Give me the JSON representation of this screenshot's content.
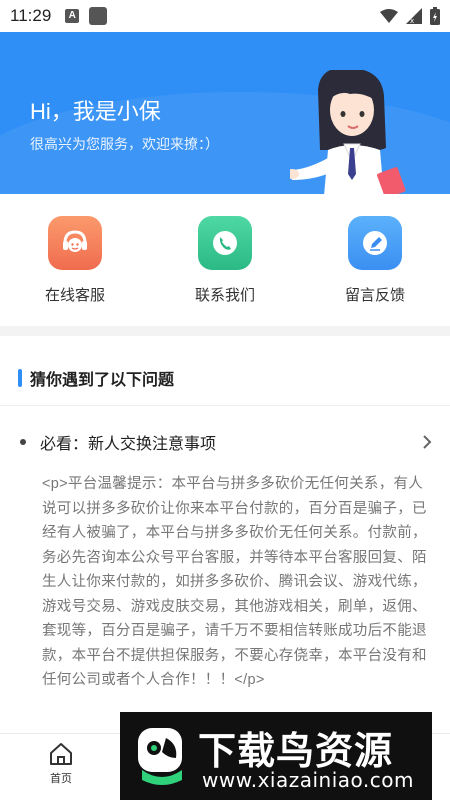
{
  "status_bar": {
    "time": "11:29",
    "notif_icon": "A"
  },
  "hero": {
    "title": "Hi，我是小保",
    "subtitle": "很高兴为您服务，欢迎来撩：）"
  },
  "actions": [
    {
      "label": "在线客服",
      "icon": "customer-service-icon",
      "color": "#f47f5a"
    },
    {
      "label": "联系我们",
      "icon": "phone-icon",
      "color": "#35c793"
    },
    {
      "label": "留言反馈",
      "icon": "edit-icon",
      "color": "#3f9ef7"
    }
  ],
  "section": {
    "title": "猜你遇到了以下问题"
  },
  "faq": {
    "title": "必看：新人交换注意事项",
    "body": "<p>平台温馨提示：本平台与拼多多砍价无任何关系，有人说可以拼多多砍价让你来本平台付款的，百分百是骗子，已经有人被骗了，本平台与拼多多砍价无任何关系。付款前，务必先咨询本公众号平台客服，并等待本平台客服回复、陌生人让你来付款的，如拼多多砍价、腾讯会议、游戏代练，游戏号交易、游戏皮肤交易，其他游戏相关，刷单，返佣、套现等，百分百是骗子，请千万不要相信转账成功后不能退款，本平台不提供担保服务，不要心存侥幸，本平台没有和任何公司或者个人合作！！！</p>"
  },
  "bottom_nav": {
    "home_label": "首页"
  },
  "watermark": {
    "title": "下载鸟资源",
    "url": "www.xiazainiao.com"
  },
  "colors": {
    "primary": "#2f8ff6"
  }
}
